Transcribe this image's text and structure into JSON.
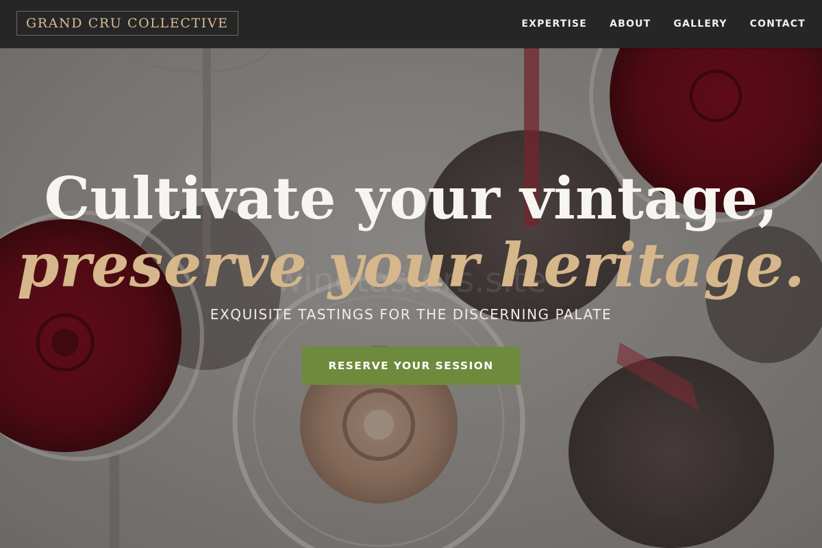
{
  "header": {
    "brand": "GRAND CRU COLLECTIVE",
    "nav": [
      {
        "label": "EXPERTISE"
      },
      {
        "label": "ABOUT"
      },
      {
        "label": "GALLERY"
      },
      {
        "label": "CONTACT"
      }
    ]
  },
  "hero": {
    "headline_line1": "Cultivate your vintage,",
    "headline_line2": "preserve your heritage.",
    "tagline": "EXQUISITE TASTINGS FOR THE DISCERNING PALATE",
    "cta_label": "RESERVE YOUR SESSION",
    "watermark": "winetasters.site"
  },
  "colors": {
    "nav_background": "#272626",
    "brand_gold": "#d8bd93",
    "headline_accent": "#d6b68b",
    "cta_green": "#6e8a3c"
  }
}
